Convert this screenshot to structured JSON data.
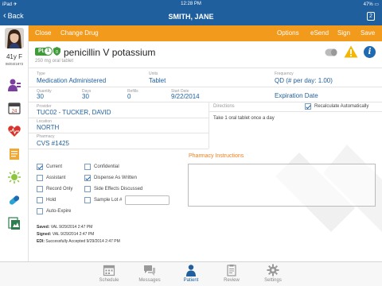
{
  "status_bar": {
    "carrier": "iPad ✈",
    "time": "12:28 PM",
    "battery": "47% ▭"
  },
  "nav": {
    "back_label": "Back",
    "title": "SMITH, JANE",
    "count_badge": "2"
  },
  "patient": {
    "age_sex": "41y F",
    "dob": "08/03/1972"
  },
  "sidebar": {
    "icons": [
      "demographics-icon",
      "calendar-icon",
      "vitals-heart-icon",
      "notes-icon",
      "allergy-icon",
      "prescription-icon",
      "documents-icon"
    ]
  },
  "toolbar": {
    "close": "Close",
    "change_drug": "Change Drug",
    "options": "Options",
    "esend": "eSend",
    "sign": "Sign",
    "save": "Save"
  },
  "drug": {
    "badge": "PL",
    "badge_number": "1",
    "shield_number": "0",
    "name": "penicillin V potassium",
    "form": "250 mg oral tablet"
  },
  "fields": {
    "type_label": "Type",
    "type_value": "Medication Administered",
    "units_label": "Units",
    "units_value": "Tablet",
    "frequency_label": "Frequency",
    "frequency_value": "QD (# per day: 1.00)",
    "quantity_label": "Quantity",
    "quantity_value": "30",
    "days_label": "Days",
    "days_value": "30",
    "refills_label": "Refills",
    "refills_value": "0",
    "start_date_label": "Start Date",
    "start_date_value": "9/22/2014",
    "expiration_label": "Expiration Date",
    "provider_label": "Provider",
    "provider_value": "TUC02 - TUCKER, DAVID",
    "location_label": "Location",
    "location_value": "NORTH",
    "pharmacy_label": "Pharmacy",
    "pharmacy_value": "CVS #1425"
  },
  "directions": {
    "label": "Directions",
    "recalc_label": "Recalculate Automatically",
    "recalc_checked": true,
    "text": "Take 1 oral tablet once a day"
  },
  "pharmacy_instructions": {
    "label": "Pharmacy Instructions",
    "value": ""
  },
  "checkboxes_left": [
    {
      "label": "Current",
      "checked": true
    },
    {
      "label": "Assistant",
      "checked": false
    },
    {
      "label": "Record Only",
      "checked": false
    },
    {
      "label": "Hold",
      "checked": false
    },
    {
      "label": "Auto-Expire",
      "checked": false
    }
  ],
  "checkboxes_right": [
    {
      "label": "Confidential",
      "checked": false
    },
    {
      "label": "Dispense As Written",
      "checked": true
    },
    {
      "label": "Side Effects Discussed",
      "checked": false
    },
    {
      "label": "Sample Lot #",
      "checked": false
    }
  ],
  "audit": {
    "saved_label": "Saved:",
    "saved_value": "VAL 9/29/2014 2:47 PM",
    "signed_label": "Signed:",
    "signed_value": "VAL 9/29/2014 2:47 PM",
    "edi_label": "EDI:",
    "edi_value": "Successfully Accepted 9/29/2014 2:47 PM"
  },
  "tabs": [
    {
      "label": "Schedule",
      "icon": "calendar-grid-icon",
      "active": false
    },
    {
      "label": "Messages",
      "icon": "chat-bubbles-icon",
      "active": false
    },
    {
      "label": "Patient",
      "icon": "person-icon",
      "active": true
    },
    {
      "label": "Review",
      "icon": "clipboard-icon",
      "active": false
    },
    {
      "label": "Settings",
      "icon": "gear-icon",
      "active": false
    }
  ],
  "colors": {
    "nav_blue": "#1f5f9e",
    "toolbar_orange": "#f29a1c",
    "accent_green": "#3f9b3a",
    "instr_orange": "#f08020"
  }
}
